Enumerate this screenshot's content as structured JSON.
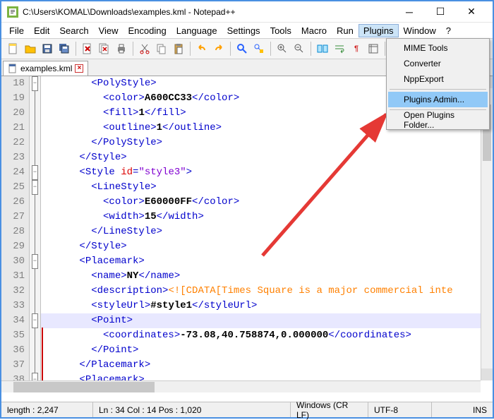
{
  "window": {
    "title": "C:\\Users\\KOMAL\\Downloads\\examples.kml - Notepad++"
  },
  "menu": {
    "items": [
      "File",
      "Edit",
      "Search",
      "View",
      "Encoding",
      "Language",
      "Settings",
      "Tools",
      "Macro",
      "Run",
      "Plugins",
      "Window",
      "?"
    ],
    "highlighted": "Plugins"
  },
  "dropdown": {
    "items": [
      "MIME Tools",
      "Converter",
      "NppExport",
      "Plugins Admin...",
      "Open Plugins Folder..."
    ],
    "highlighted": "Plugins Admin..."
  },
  "tab": {
    "name": "examples.kml"
  },
  "gutter": {
    "start": 18,
    "end": 38
  },
  "status": {
    "length": "length : 2,247",
    "pos": "Ln : 34    Col : 14    Pos : 1,020",
    "eol": "Windows (CR LF)",
    "enc": "UTF-8",
    "mode": "INS"
  },
  "code": {
    "lines": [
      {
        "indent": 16,
        "parts": [
          {
            "c": "t-tag",
            "t": "<PolyStyle>"
          }
        ]
      },
      {
        "indent": 20,
        "parts": [
          {
            "c": "t-tag",
            "t": "<color>"
          },
          {
            "c": "t-txt",
            "t": "A600CC33"
          },
          {
            "c": "t-tag",
            "t": "</color>"
          }
        ]
      },
      {
        "indent": 20,
        "parts": [
          {
            "c": "t-tag",
            "t": "<fill>"
          },
          {
            "c": "t-txt",
            "t": "1"
          },
          {
            "c": "t-tag",
            "t": "</fill>"
          }
        ]
      },
      {
        "indent": 20,
        "parts": [
          {
            "c": "t-tag",
            "t": "<outline>"
          },
          {
            "c": "t-txt",
            "t": "1"
          },
          {
            "c": "t-tag",
            "t": "</outline>"
          }
        ]
      },
      {
        "indent": 16,
        "parts": [
          {
            "c": "t-tag",
            "t": "</PolyStyle>"
          }
        ]
      },
      {
        "indent": 12,
        "parts": [
          {
            "c": "t-tag",
            "t": "</Style>"
          }
        ]
      },
      {
        "indent": 12,
        "parts": [
          {
            "c": "t-tag",
            "t": "<Style "
          },
          {
            "c": "t-attr",
            "t": "id"
          },
          {
            "c": "t-tag",
            "t": "="
          },
          {
            "c": "t-str",
            "t": "\"style3\""
          },
          {
            "c": "t-tag",
            "t": ">"
          }
        ]
      },
      {
        "indent": 16,
        "parts": [
          {
            "c": "t-tag",
            "t": "<LineStyle>"
          }
        ]
      },
      {
        "indent": 20,
        "parts": [
          {
            "c": "t-tag",
            "t": "<color>"
          },
          {
            "c": "t-txt",
            "t": "E60000FF"
          },
          {
            "c": "t-tag",
            "t": "</color>"
          }
        ]
      },
      {
        "indent": 20,
        "parts": [
          {
            "c": "t-tag",
            "t": "<width>"
          },
          {
            "c": "t-txt",
            "t": "15"
          },
          {
            "c": "t-tag",
            "t": "</width>"
          }
        ]
      },
      {
        "indent": 16,
        "parts": [
          {
            "c": "t-tag",
            "t": "</LineStyle>"
          }
        ]
      },
      {
        "indent": 12,
        "parts": [
          {
            "c": "t-tag",
            "t": "</Style>"
          }
        ]
      },
      {
        "indent": 12,
        "parts": [
          {
            "c": "t-tag",
            "t": "<Placemark>"
          }
        ]
      },
      {
        "indent": 16,
        "parts": [
          {
            "c": "t-tag",
            "t": "<name>"
          },
          {
            "c": "t-txt",
            "t": "NY"
          },
          {
            "c": "t-tag",
            "t": "</name>"
          }
        ]
      },
      {
        "indent": 16,
        "parts": [
          {
            "c": "t-tag",
            "t": "<description>"
          },
          {
            "c": "t-cdata",
            "t": "<![CDATA[Times Square is a major commercial inte"
          }
        ]
      },
      {
        "indent": 16,
        "parts": [
          {
            "c": "t-tag",
            "t": "<styleUrl>"
          },
          {
            "c": "t-txt",
            "t": "#style1"
          },
          {
            "c": "t-tag",
            "t": "</styleUrl>"
          }
        ]
      },
      {
        "indent": 16,
        "parts": [
          {
            "c": "t-tag",
            "t": "<Point>"
          }
        ],
        "hl": true
      },
      {
        "indent": 20,
        "parts": [
          {
            "c": "t-tag",
            "t": "<coordinates>"
          },
          {
            "c": "t-txt",
            "t": "-73.08,40.758874,0.000000"
          },
          {
            "c": "t-tag",
            "t": "</coordinates>"
          }
        ]
      },
      {
        "indent": 16,
        "parts": [
          {
            "c": "t-tag",
            "t": "</Point>"
          }
        ]
      },
      {
        "indent": 12,
        "parts": [
          {
            "c": "t-tag",
            "t": "</Placemark>"
          }
        ]
      },
      {
        "indent": 12,
        "parts": [
          {
            "c": "t-tag",
            "t": "<Placemark>"
          }
        ]
      }
    ]
  },
  "icons": {
    "toolbar": [
      "new",
      "open",
      "save",
      "save-all",
      "close",
      "close-all",
      "print",
      "cut",
      "copy",
      "paste",
      "undo",
      "redo",
      "find",
      "replace",
      "zoom-in",
      "zoom-out",
      "sync",
      "wrap",
      "show-all",
      "indent",
      "lang",
      "monitor",
      "record",
      "play"
    ]
  }
}
